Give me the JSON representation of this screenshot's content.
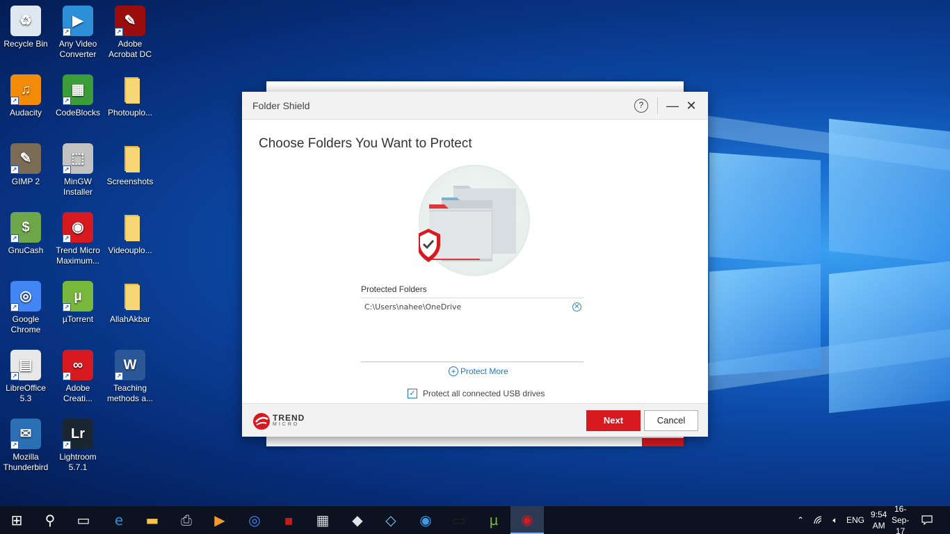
{
  "desktop": {
    "icons": [
      {
        "label": "Recycle Bin",
        "icon": "recycle-bin-icon"
      },
      {
        "label": "Any Video Converter",
        "icon": "any-video-converter-icon"
      },
      {
        "label": "Adobe Acrobat DC",
        "icon": "adobe-acrobat-icon"
      },
      {
        "label": "Audacity",
        "icon": "audacity-icon"
      },
      {
        "label": "CodeBlocks",
        "icon": "codeblocks-icon"
      },
      {
        "label": "Photouplo...",
        "icon": "folder-icon"
      },
      {
        "label": "GIMP 2",
        "icon": "gimp-icon"
      },
      {
        "label": "MinGW Installer",
        "icon": "mingw-installer-icon"
      },
      {
        "label": "Screenshots",
        "icon": "folder-icon"
      },
      {
        "label": "GnuCash",
        "icon": "gnucash-icon"
      },
      {
        "label": "Trend Micro Maximum...",
        "icon": "trend-micro-icon"
      },
      {
        "label": "Videouplo...",
        "icon": "folder-icon"
      },
      {
        "label": "Google Chrome",
        "icon": "chrome-icon"
      },
      {
        "label": "µTorrent",
        "icon": "utorrent-icon"
      },
      {
        "label": "AllahAkbar",
        "icon": "folder-icon"
      },
      {
        "label": "LibreOffice 5.3",
        "icon": "libreoffice-icon"
      },
      {
        "label": "Adobe Creati...",
        "icon": "adobe-creative-cloud-icon"
      },
      {
        "label": "Teaching methods a...",
        "icon": "word-document-icon"
      },
      {
        "label": "Mozilla Thunderbird",
        "icon": "thunderbird-icon"
      },
      {
        "label": "Lightroom 5.7.1",
        "icon": "lightroom-icon"
      }
    ]
  },
  "dialog": {
    "title": "Folder Shield",
    "help_glyph": "?",
    "minimize_glyph": "—",
    "close_glyph": "✕",
    "heading": "Choose Folders You Want to Protect",
    "protected_folders_label": "Protected Folders",
    "folders": [
      {
        "path": "C:\\Users\\nahee\\OneDrive"
      }
    ],
    "protect_more": "Protect More",
    "usb_label": "Protect all connected USB drives",
    "usb_checked": true,
    "logo_line1": "TREND",
    "logo_line2": "MICRO",
    "next_label": "Next",
    "cancel_label": "Cancel",
    "colors": {
      "brand_red": "#d71920",
      "link_blue": "#1e78c2"
    }
  },
  "taskbar": {
    "items": [
      "start-icon",
      "search-icon",
      "task-view-icon",
      "edge-icon",
      "file-explorer-icon",
      "printer-app-icon",
      "media-player-icon",
      "chrome-icon",
      "project-app-icon",
      "calculator-icon",
      "paint-app-icon",
      "notepad-app-icon",
      "internet-app-icon",
      "command-prompt-icon",
      "utorrent-icon",
      "trend-micro-icon"
    ],
    "language": "ENG",
    "time": "9:54 AM",
    "date": "16-Sep-17"
  }
}
